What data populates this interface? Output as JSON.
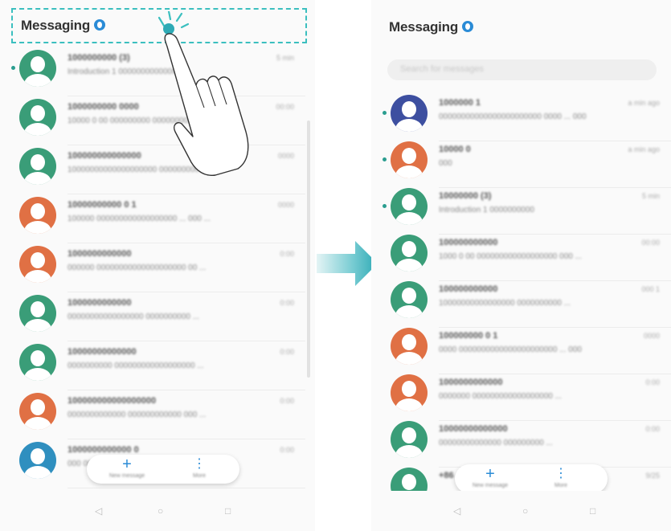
{
  "colors": {
    "accent": "#2a8bd6",
    "tap_highlight": "#3bbfbf",
    "arrow": "#2eaab5",
    "avatar_green": "#3a9d78",
    "avatar_orange": "#e07044",
    "avatar_blue": "#2f8fbf",
    "avatar_indigo": "#3d4fa0"
  },
  "icons": {
    "info_badge": "info-circle-icon",
    "tap_hand": "tap-gesture-hand-icon",
    "arrow": "right-arrow-icon",
    "avatar": "contact-avatar-icon",
    "new_message": "plus-icon",
    "more": "more-vertical-icon",
    "back": "back-triangle-icon",
    "home": "home-circle-icon",
    "recents": "recents-square-icon"
  },
  "left_screen": {
    "title": "Messaging",
    "conversations": [
      {
        "name": "1000000000 (3)",
        "preview": "Introduction 1 00000000000000",
        "time": "5 min",
        "avatar_color": "#3a9d78",
        "unread": true
      },
      {
        "name": "1000000000 0000",
        "preview": "10000 0 00 000000000 000000000000 ...",
        "time": "00:00",
        "avatar_color": "#3a9d78",
        "unread": false
      },
      {
        "name": "100000000000000",
        "preview": "10000000000000000000 0000000000 ...",
        "time": "0000",
        "avatar_color": "#3a9d78",
        "unread": false
      },
      {
        "name": "10000000000 0 1",
        "preview": "100000 000000000000000000 ... 000 ...",
        "time": "0000",
        "avatar_color": "#e07044",
        "unread": false
      },
      {
        "name": "1000000000000",
        "preview": "000000 00000000000000000000 00 ...",
        "time": "0:00",
        "avatar_color": "#e07044",
        "unread": false
      },
      {
        "name": "1000000000000",
        "preview": "00000000000000000 0000000000 ...",
        "time": "0:00",
        "avatar_color": "#3a9d78",
        "unread": false
      },
      {
        "name": "10000000000000",
        "preview": "0000000000 000000000000000000 ...",
        "time": "0:00",
        "avatar_color": "#3a9d78",
        "unread": false
      },
      {
        "name": "100000000000000000",
        "preview": "0000000000000 000000000000 000 ...",
        "time": "0:00",
        "avatar_color": "#e07044",
        "unread": false
      },
      {
        "name": "1000000000000 0",
        "preview": "000 000000000 0000 ...",
        "time": "0:00",
        "avatar_color": "#2f8fbf",
        "unread": false
      },
      {
        "name": "",
        "preview": "",
        "time": "",
        "avatar_color": "#2f8fbf",
        "unread": false
      }
    ],
    "fab": {
      "new_label": "New message",
      "more_label": "More"
    }
  },
  "right_screen": {
    "title": "Messaging",
    "search_placeholder": "Search for messages",
    "conversations": [
      {
        "name": "1000000 1",
        "preview": "00000000000000000000000 0000 ... 000",
        "time": "a min ago",
        "avatar_color": "#3d4fa0",
        "unread": true
      },
      {
        "name": "10000 0",
        "preview": "000",
        "time": "a min ago",
        "avatar_color": "#e07044",
        "unread": true
      },
      {
        "name": "10000000 (3)",
        "preview": "Introduction 1 0000000000",
        "time": "5 min",
        "avatar_color": "#3a9d78",
        "unread": true
      },
      {
        "name": "100000000000",
        "preview": "1000 0 00 000000000000000000 000 ...",
        "time": "00:00",
        "avatar_color": "#3a9d78",
        "unread": false
      },
      {
        "name": "100000000000",
        "preview": "10000000000000000 0000000000 ...",
        "time": "000 1",
        "avatar_color": "#3a9d78",
        "unread": false
      },
      {
        "name": "100000000 0 1",
        "preview": "0000 0000000000000000000000 ... 000",
        "time": "0000",
        "avatar_color": "#e07044",
        "unread": false
      },
      {
        "name": "1000000000000",
        "preview": "0000000 000000000000000000 ...",
        "time": "0:00",
        "avatar_color": "#e07044",
        "unread": false
      },
      {
        "name": "10000000000000",
        "preview": "00000000000000 000000000 ...",
        "time": "0:00",
        "avatar_color": "#3a9d78",
        "unread": false
      },
      {
        "name": "+86",
        "preview": "",
        "time": "9/25",
        "avatar_color": "#3a9d78",
        "unread": false
      }
    ],
    "fab": {
      "new_label": "New message",
      "more_label": "More"
    }
  }
}
